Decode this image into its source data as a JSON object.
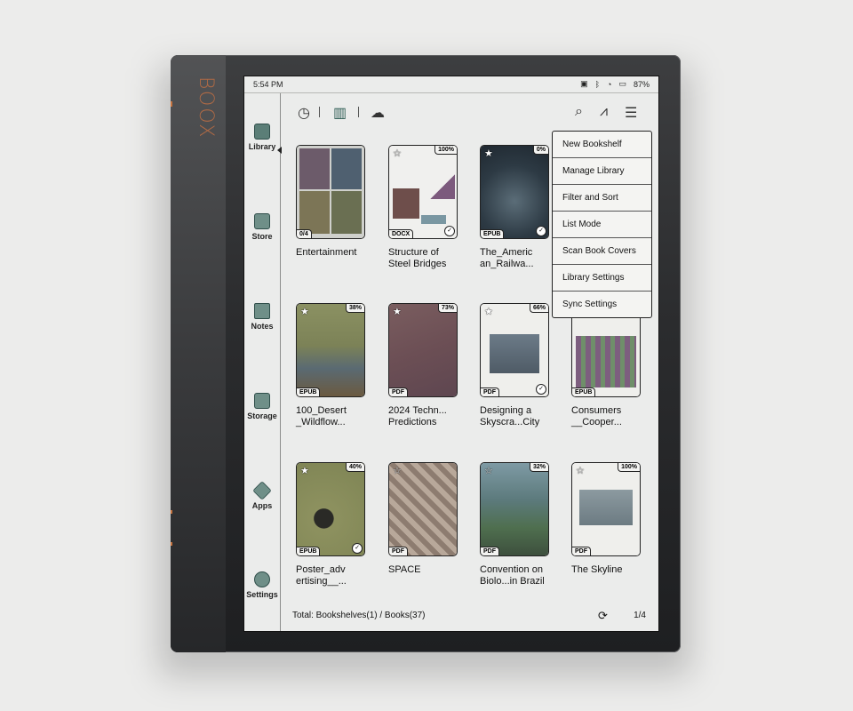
{
  "device": {
    "brand": "BOOX"
  },
  "statusbar": {
    "time": "5:54 PM",
    "battery": "87%"
  },
  "sidebar": {
    "items": [
      {
        "label": "Library",
        "icon": "library-icon"
      },
      {
        "label": "Store",
        "icon": "store-icon"
      },
      {
        "label": "Notes",
        "icon": "notes-icon"
      },
      {
        "label": "Storage",
        "icon": "storage-icon"
      },
      {
        "label": "Apps",
        "icon": "apps-icon"
      },
      {
        "label": "Settings",
        "icon": "settings-icon"
      }
    ]
  },
  "toolbar": {
    "icons": [
      "recent-clock-icon",
      "bookshelf-icon",
      "cloud-icon",
      "search-icon",
      "statistics-icon",
      "menu-list-icon"
    ]
  },
  "books": [
    {
      "title": "Entertainment",
      "badge": "0/4",
      "progress": "",
      "type": "shelf"
    },
    {
      "title": "Structure of\nSteel Bridges",
      "badge": "DOCX",
      "progress": "100%",
      "done": true
    },
    {
      "title": "The_Americ\nan_Railwa...",
      "badge": "EPUB",
      "progress": "0%",
      "done": true
    },
    {
      "title": "",
      "badge": "",
      "progress": "",
      "hidden": true
    },
    {
      "title": "100_Desert\n_Wildflow...",
      "badge": "EPUB",
      "progress": "38%"
    },
    {
      "title": "2024 Techn...\nPredictions",
      "badge": "PDF",
      "progress": "73%"
    },
    {
      "title": "Designing a\nSkyscra...City",
      "badge": "PDF",
      "progress": "66%",
      "done": true
    },
    {
      "title": "Consumers\n__Cooper...",
      "badge": "EPUB",
      "progress": ""
    },
    {
      "title": "Poster_adv\nertising__...",
      "badge": "EPUB",
      "progress": "40%",
      "done": true
    },
    {
      "title": "SPACE",
      "badge": "PDF",
      "progress": ""
    },
    {
      "title": "Convention on\nBiolo...in Brazil",
      "badge": "PDF",
      "progress": "32%"
    },
    {
      "title": "The Skyline",
      "badge": "PDF",
      "progress": "100%"
    }
  ],
  "menu": {
    "items": [
      "New Bookshelf",
      "Manage Library",
      "Filter and Sort",
      "List Mode",
      "Scan Book Covers",
      "Library Settings",
      "Sync Settings"
    ]
  },
  "footer": {
    "total": "Total: Bookshelves(1) / Books(37)",
    "page": "1/4"
  },
  "colors": {
    "accent": "#c8743f",
    "icon_teal": "#5b7e77"
  }
}
